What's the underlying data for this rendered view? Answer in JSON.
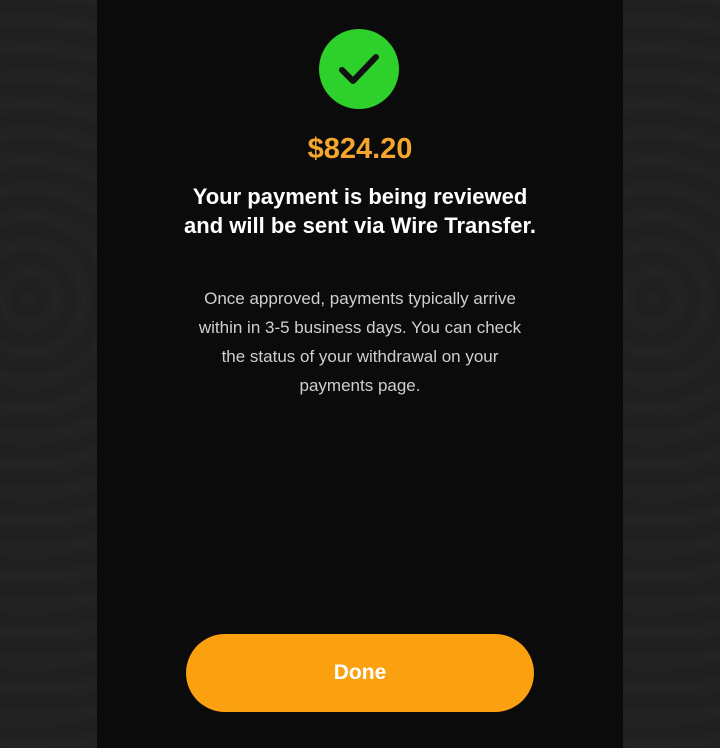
{
  "payment": {
    "amount": "$824.20",
    "headline": "Your payment is being reviewed and will be sent via Wire Transfer.",
    "description": "Once approved, payments typically arrive within in 3-5 business days. You can check the status of your withdrawal on your payments page."
  },
  "actions": {
    "done_label": "Done"
  },
  "icons": {
    "status": "check-circle-icon"
  },
  "colors": {
    "success": "#2ed12b",
    "accent": "#f4a72c",
    "button": "#fba10f",
    "panel": "#0b0b0b"
  }
}
